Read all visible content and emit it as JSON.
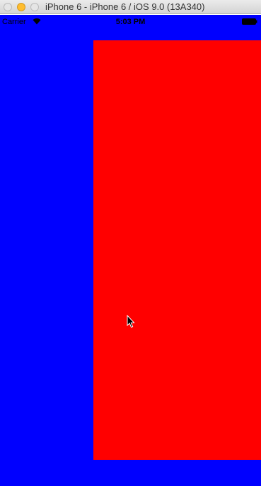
{
  "window": {
    "title": "iPhone 6 - iPhone 6 / iOS 9.0 (13A340)"
  },
  "status_bar": {
    "carrier": "Carrier",
    "time": "5:03 PM",
    "icons": [
      "wifi-icon",
      "battery-icon"
    ]
  },
  "colors": {
    "background": "#0000ff",
    "panel": "#ff0000",
    "traffic_close": "#e5e5e5",
    "traffic_minimize": "#ffbd2e",
    "traffic_maximize": "#e5e5e5"
  },
  "cursor": {
    "icon": "arrow-cursor-icon"
  }
}
